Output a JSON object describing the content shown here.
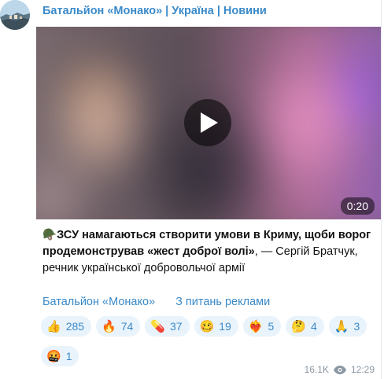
{
  "channel": {
    "name": "Батальйон «Монако» | Україна | Новини"
  },
  "video": {
    "duration": "0:20"
  },
  "post": {
    "emoji": "🪖",
    "bold_text": "ЗСУ намагаються створити умови в Криму, щоби ворог продемонстрував «жест доброї волі»",
    "tail_text": ", — Сергій Братчук, речник української добровольчої армії"
  },
  "inline_buttons": [
    {
      "label": "Батальйон «Монако»"
    },
    {
      "label": "З питань реклами"
    }
  ],
  "reactions": [
    {
      "emoji": "👍",
      "count": "285"
    },
    {
      "emoji": "🔥",
      "count": "74"
    },
    {
      "emoji": "💊",
      "count": "37"
    },
    {
      "emoji": "🥴",
      "count": "19"
    },
    {
      "emoji": "❤️‍🔥",
      "count": "5"
    },
    {
      "emoji": "🤔",
      "count": "4"
    },
    {
      "emoji": "🙏",
      "count": "3"
    },
    {
      "emoji": "🤬",
      "count": "1"
    }
  ],
  "meta": {
    "views": "16.1K",
    "time": "12:29"
  }
}
